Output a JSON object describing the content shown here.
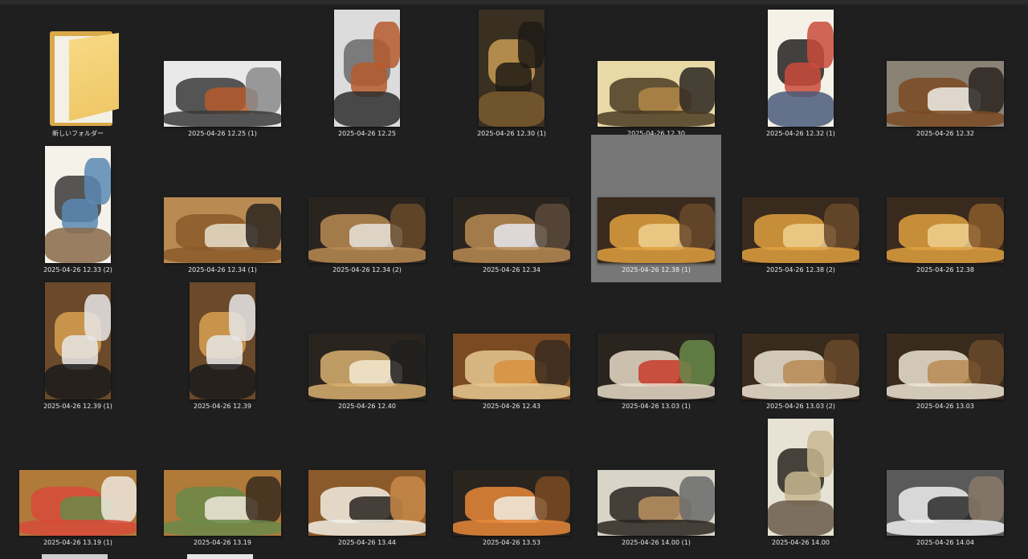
{
  "colors": {
    "background": "#1f1f1f",
    "selection": "#777777",
    "caption_text": "#e8e8e8"
  },
  "folder": {
    "label": "新しいフォルダー",
    "icon": "folder-icon"
  },
  "files": [
    {
      "name": "2025-04-26 12.25 (1)",
      "orient": "land",
      "palette": [
        "#e9e9e9",
        "#3a3a3a",
        "#b65a2b",
        "#8a8a8a"
      ]
    },
    {
      "name": "2025-04-26 12.25",
      "orient": "port",
      "palette": [
        "#dcdcdc",
        "#6a6a6a",
        "#b65a2b",
        "#2e2e2e"
      ]
    },
    {
      "name": "2025-04-26 12.30 (1)",
      "orient": "port",
      "palette": [
        "#3a3022",
        "#c89a52",
        "#1e1a15",
        "#7a5a2e"
      ]
    },
    {
      "name": "2025-04-26 12.30",
      "orient": "land",
      "palette": [
        "#e8d9a6",
        "#4a3a22",
        "#b28746",
        "#2a2420"
      ]
    },
    {
      "name": "2025-04-26 12.32 (1)",
      "orient": "port",
      "palette": [
        "#f4f1e6",
        "#222222",
        "#c94b3b",
        "#4a5a7a"
      ]
    },
    {
      "name": "2025-04-26 12.32",
      "orient": "land",
      "palette": [
        "#8a8376",
        "#7a4a22",
        "#f0eee6",
        "#2a2420"
      ]
    },
    {
      "name": "2025-04-26 12.33 (2)",
      "orient": "port",
      "palette": [
        "#f4f2ea",
        "#3a3a3a",
        "#5a8ab4",
        "#8a6a4a"
      ]
    },
    {
      "name": "2025-04-26 12.34 (1)",
      "orient": "land",
      "palette": [
        "#b98a52",
        "#8a5a2a",
        "#e8e0cc",
        "#2a2420"
      ]
    },
    {
      "name": "2025-04-26 12.34 (2)",
      "orient": "land",
      "palette": [
        "#2a2420",
        "#b98a52",
        "#e8e4da",
        "#6a4a2a"
      ]
    },
    {
      "name": "2025-04-26 12.34",
      "orient": "land",
      "palette": [
        "#2a2420",
        "#b98a52",
        "#e8e8ee",
        "#5a4a3a"
      ]
    },
    {
      "name": "2025-04-26 12.38 (1)",
      "orient": "land",
      "palette": [
        "#3a2a1e",
        "#e0a040",
        "#f0d090",
        "#6a4a2a"
      ],
      "selected": true
    },
    {
      "name": "2025-04-26 12.38 (2)",
      "orient": "land",
      "palette": [
        "#3a2a1e",
        "#e0a040",
        "#f0d090",
        "#6a4a2a"
      ]
    },
    {
      "name": "2025-04-26 12.38",
      "orient": "land",
      "palette": [
        "#3a2a1e",
        "#e0a040",
        "#f0d090",
        "#8a5a2a"
      ]
    },
    {
      "name": "2025-04-26 12.39 (1)",
      "orient": "port",
      "palette": [
        "#6a4a2a",
        "#d8a050",
        "#e6e6e6",
        "#1a1a1a"
      ]
    },
    {
      "name": "2025-04-26 12.39",
      "orient": "port",
      "palette": [
        "#6a4a2a",
        "#d8a050",
        "#e6e6e6",
        "#1a1a1a"
      ]
    },
    {
      "name": "2025-04-26 12.40",
      "orient": "land",
      "palette": [
        "#2a2420",
        "#d8b070",
        "#f4ead0",
        "#202020"
      ]
    },
    {
      "name": "2025-04-26 12.43",
      "orient": "land",
      "palette": [
        "#7a4a22",
        "#e8c890",
        "#d89040",
        "#3a2a1e"
      ]
    },
    {
      "name": "2025-04-26 13.03 (1)",
      "orient": "land",
      "palette": [
        "#2a2420",
        "#e8dcc8",
        "#c83a2a",
        "#6a8a4a"
      ]
    },
    {
      "name": "2025-04-26 13.03 (2)",
      "orient": "land",
      "palette": [
        "#3a2a1e",
        "#ece4d4",
        "#b88a52",
        "#6a4a2a"
      ]
    },
    {
      "name": "2025-04-26 13.03",
      "orient": "land",
      "palette": [
        "#3a2a1e",
        "#ece4d4",
        "#b88a52",
        "#6a4a2a"
      ]
    },
    {
      "name": "2025-04-26 13.19 (1)",
      "orient": "land",
      "palette": [
        "#b07a3a",
        "#d84a3a",
        "#6a8a4a",
        "#eee8dc"
      ]
    },
    {
      "name": "2025-04-26 13.19",
      "orient": "land",
      "palette": [
        "#b07a3a",
        "#6a8a4a",
        "#eee8dc",
        "#3a2a1e"
      ]
    },
    {
      "name": "2025-04-26 13.44",
      "orient": "land",
      "palette": [
        "#8a5a2a",
        "#f2eee4",
        "#2a2420",
        "#c88a4a"
      ]
    },
    {
      "name": "2025-04-26 13.53",
      "orient": "land",
      "palette": [
        "#2a2420",
        "#e8883a",
        "#f2ece0",
        "#7a4a22"
      ]
    },
    {
      "name": "2025-04-26 14.00 (1)",
      "orient": "land",
      "palette": [
        "#d8d4c8",
        "#2a2420",
        "#b89060",
        "#6a6a6a"
      ]
    },
    {
      "name": "2025-04-26 14.00",
      "orient": "port",
      "palette": [
        "#e6e2d4",
        "#2a2420",
        "#c8b890",
        "#6a5a4a"
      ]
    },
    {
      "name": "2025-04-26 14.04",
      "orient": "land",
      "palette": [
        "#5a5a5a",
        "#eeeeee",
        "#2a2a2a",
        "#8a7a6a"
      ]
    }
  ]
}
